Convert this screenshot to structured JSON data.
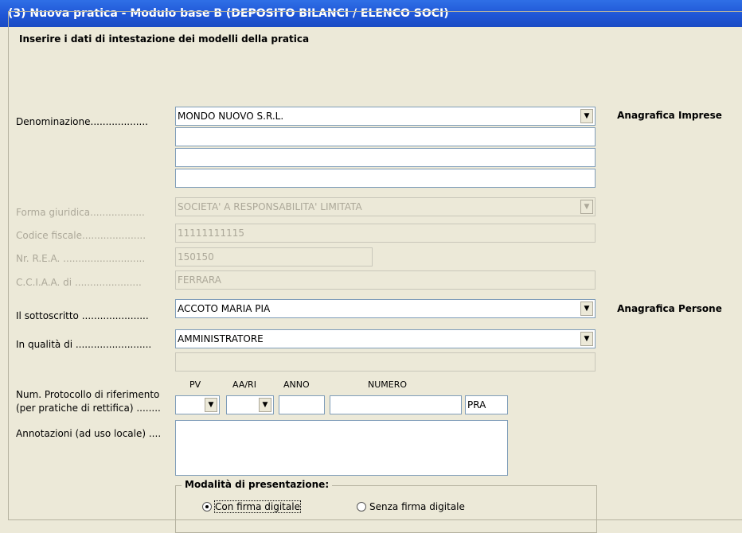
{
  "title": "(3) Nuova pratica - Modulo base B (DEPOSITO BILANCI / ELENCO SOCI)",
  "group_title": "Inserire i dati di intestazione dei modelli della pratica",
  "denominazione": {
    "label": "Denominazione...................",
    "value": "MONDO NUOVO S.R.L.",
    "extra_lines": [
      "",
      "",
      ""
    ],
    "button": "Anagrafica Imprese"
  },
  "forma_giuridica": {
    "label": "Forma giuridica..................",
    "value": "SOCIETA' A RESPONSABILITA' LIMITATA"
  },
  "codice_fiscale": {
    "label": "Codice fiscale.....................",
    "value": "11111111115"
  },
  "nr_rea": {
    "label": "Nr. R.E.A. ...........................",
    "value": "150150"
  },
  "cciaa": {
    "label": "C.C.I.A.A. di ......................",
    "value": "FERRARA"
  },
  "sottoscritto": {
    "label": "Il sottoscritto ......................",
    "value": "ACCOTO MARIA PIA",
    "button": "Anagrafica Persone"
  },
  "qualita": {
    "label": "In qualità di .........................",
    "value": "AMMINISTRATORE",
    "extra": ""
  },
  "protocollo": {
    "label_line1": "Num. Protocollo di riferimento",
    "label_line2": "(per pratiche di rettifica) ........",
    "col_pv": "PV",
    "col_aari": "AA/RI",
    "col_anno": "ANNO",
    "col_numero": "NUMERO",
    "pv": "",
    "aari": "",
    "anno": "",
    "numero": "",
    "suffix": "PRA"
  },
  "annotazioni": {
    "label": "Annotazioni (ad uso locale) ....",
    "value": ""
  },
  "modalita": {
    "title": "Modalità di presentazione:",
    "option1": "Con firma digitale",
    "option2": "Senza firma digitale",
    "selected": "option1"
  }
}
